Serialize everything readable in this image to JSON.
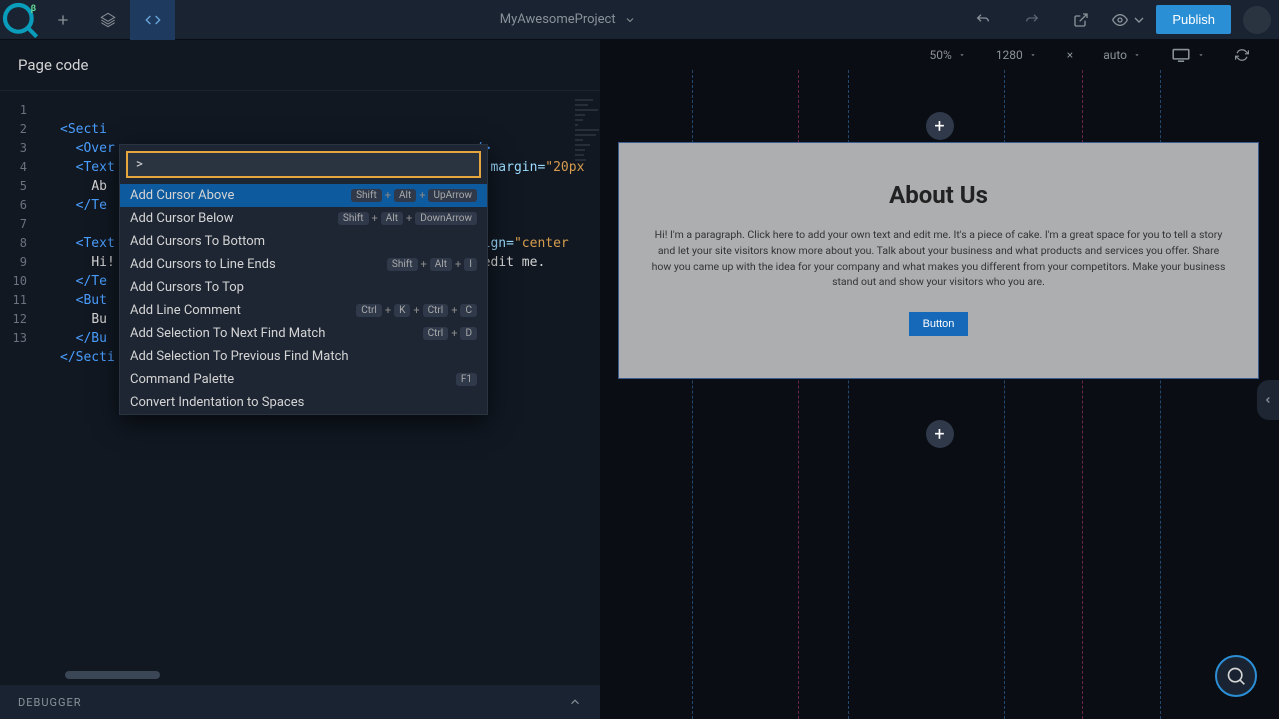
{
  "toolbar": {
    "project_name": "MyAwesomeProject",
    "publish_label": "Publish"
  },
  "panel": {
    "title": "Page code"
  },
  "viewport": {
    "zoom": "50%",
    "width": "1280",
    "times": "×",
    "height": "auto"
  },
  "code": {
    "lines": [
      "1",
      "2",
      "3",
      "4",
      "5",
      "6",
      "7",
      "8",
      "9",
      "10",
      "11",
      "12",
      "13"
    ],
    "l1_tag": "<Secti",
    "l2": "<Over",
    "l2_end": "/>",
    "l3_tag": "<Text",
    "l3_attr": " margin=",
    "l3_val": "\"20px",
    "l4": "Ab",
    "l5": "</Te",
    "l7_tag": "<Text",
    "l7_attr": "t-align=",
    "l7_val": "\"center",
    "l8_a": "Hi!",
    "l8_b": "t and edit me.",
    "l9": "</Te",
    "l10": "<But",
    "l11": "Bu",
    "l12": "</Bu",
    "l13": "</Secti"
  },
  "palette": {
    "input_value": ">",
    "items": [
      {
        "label": "Add Cursor Above",
        "shortcut": [
          "Shift",
          "Alt",
          "UpArrow"
        ],
        "selected": true
      },
      {
        "label": "Add Cursor Below",
        "shortcut": [
          "Shift",
          "Alt",
          "DownArrow"
        ]
      },
      {
        "label": "Add Cursors To Bottom",
        "shortcut": []
      },
      {
        "label": "Add Cursors to Line Ends",
        "shortcut": [
          "Shift",
          "Alt",
          "I"
        ]
      },
      {
        "label": "Add Cursors To Top",
        "shortcut": []
      },
      {
        "label": "Add Line Comment",
        "shortcut": [
          "Ctrl",
          "K",
          "Ctrl",
          "C"
        ]
      },
      {
        "label": "Add Selection To Next Find Match",
        "shortcut": [
          "Ctrl",
          "D"
        ]
      },
      {
        "label": "Add Selection To Previous Find Match",
        "shortcut": []
      },
      {
        "label": "Command Palette",
        "shortcut": [
          "F1"
        ]
      },
      {
        "label": "Convert Indentation to Spaces",
        "shortcut": []
      }
    ]
  },
  "debugger": {
    "label": "DEBUGGER"
  },
  "preview": {
    "title": "About Us",
    "paragraph": "Hi! I'm a paragraph. Click here to add your own text and edit me. It's a piece of cake. I'm a great space for you to tell a story and let your site visitors know more about you. Talk about your business and what products and services you offer. Share how you came up with the idea for your company and what makes you different from your competitors. Make your business stand out and show your visitors who you are.",
    "button_label": "Button"
  }
}
